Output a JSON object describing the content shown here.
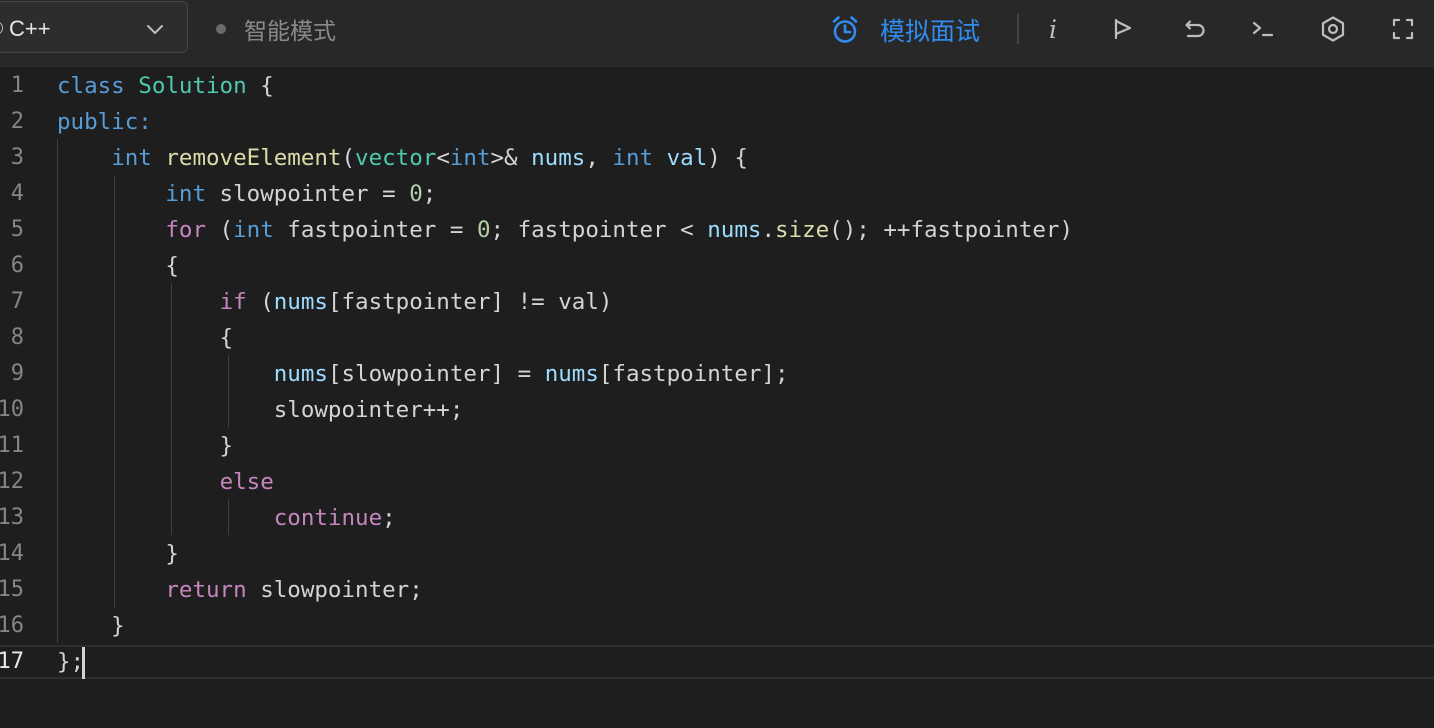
{
  "toolbar": {
    "language": "C++",
    "mode_label": "智能模式",
    "interview_label": "模拟面试",
    "info_glyph": "i"
  },
  "editor": {
    "line_numbers": [
      "1",
      "2",
      "3",
      "4",
      "5",
      "6",
      "7",
      "8",
      "9",
      "10",
      "11",
      "12",
      "13",
      "14",
      "15",
      "16",
      "17"
    ],
    "active_line": 17,
    "lines": [
      [
        {
          "t": "class",
          "c": "kw"
        },
        {
          "t": " "
        },
        {
          "t": "Solution",
          "c": "ty"
        },
        {
          "t": " {"
        }
      ],
      [
        {
          "t": "public:",
          "c": "kw"
        }
      ],
      [
        {
          "t": "    "
        },
        {
          "t": "int",
          "c": "kw"
        },
        {
          "t": " "
        },
        {
          "t": "removeElement",
          "c": "fn"
        },
        {
          "t": "("
        },
        {
          "t": "vector",
          "c": "ty"
        },
        {
          "t": "<"
        },
        {
          "t": "int",
          "c": "kw"
        },
        {
          "t": ">& "
        },
        {
          "t": "nums",
          "c": "va"
        },
        {
          "t": ", "
        },
        {
          "t": "int",
          "c": "kw"
        },
        {
          "t": " "
        },
        {
          "t": "val",
          "c": "va"
        },
        {
          "t": ") {"
        }
      ],
      [
        {
          "t": "        "
        },
        {
          "t": "int",
          "c": "kw"
        },
        {
          "t": " slowpointer = "
        },
        {
          "t": "0",
          "c": "nu"
        },
        {
          "t": ";"
        }
      ],
      [
        {
          "t": "        "
        },
        {
          "t": "for",
          "c": "ct"
        },
        {
          "t": " ("
        },
        {
          "t": "int",
          "c": "kw"
        },
        {
          "t": " fastpointer = "
        },
        {
          "t": "0",
          "c": "nu"
        },
        {
          "t": "; fastpointer < "
        },
        {
          "t": "nums",
          "c": "va"
        },
        {
          "t": "."
        },
        {
          "t": "size",
          "c": "fn"
        },
        {
          "t": "(); ++fastpointer)"
        }
      ],
      [
        {
          "t": "        {"
        }
      ],
      [
        {
          "t": "            "
        },
        {
          "t": "if",
          "c": "ct"
        },
        {
          "t": " ("
        },
        {
          "t": "nums",
          "c": "va"
        },
        {
          "t": "[fastpointer] != val)"
        }
      ],
      [
        {
          "t": "            {"
        }
      ],
      [
        {
          "t": "                "
        },
        {
          "t": "nums",
          "c": "va"
        },
        {
          "t": "[slowpointer] = "
        },
        {
          "t": "nums",
          "c": "va"
        },
        {
          "t": "[fastpointer];"
        }
      ],
      [
        {
          "t": "                slowpointer++;"
        }
      ],
      [
        {
          "t": "            }"
        }
      ],
      [
        {
          "t": "            "
        },
        {
          "t": "else",
          "c": "ct"
        }
      ],
      [
        {
          "t": "                "
        },
        {
          "t": "continue",
          "c": "ct"
        },
        {
          "t": ";"
        }
      ],
      [
        {
          "t": "        }"
        }
      ],
      [
        {
          "t": "        "
        },
        {
          "t": "return",
          "c": "ct"
        },
        {
          "t": " slowpointer;"
        }
      ],
      [
        {
          "t": "    }"
        }
      ],
      [
        {
          "t": "};"
        }
      ]
    ]
  },
  "colors": {
    "accent": "#2f8cf0",
    "keyword": "#569cd6",
    "type": "#4ec9b0",
    "function": "#dcdcaa",
    "variable": "#9cdcfe",
    "number": "#b5cea8",
    "control": "#c586c0"
  },
  "icons": [
    "chevron-down-icon",
    "alarm-clock-icon",
    "info-icon",
    "flag-icon",
    "reset-icon",
    "terminal-icon",
    "settings-icon",
    "fullscreen-icon"
  ]
}
